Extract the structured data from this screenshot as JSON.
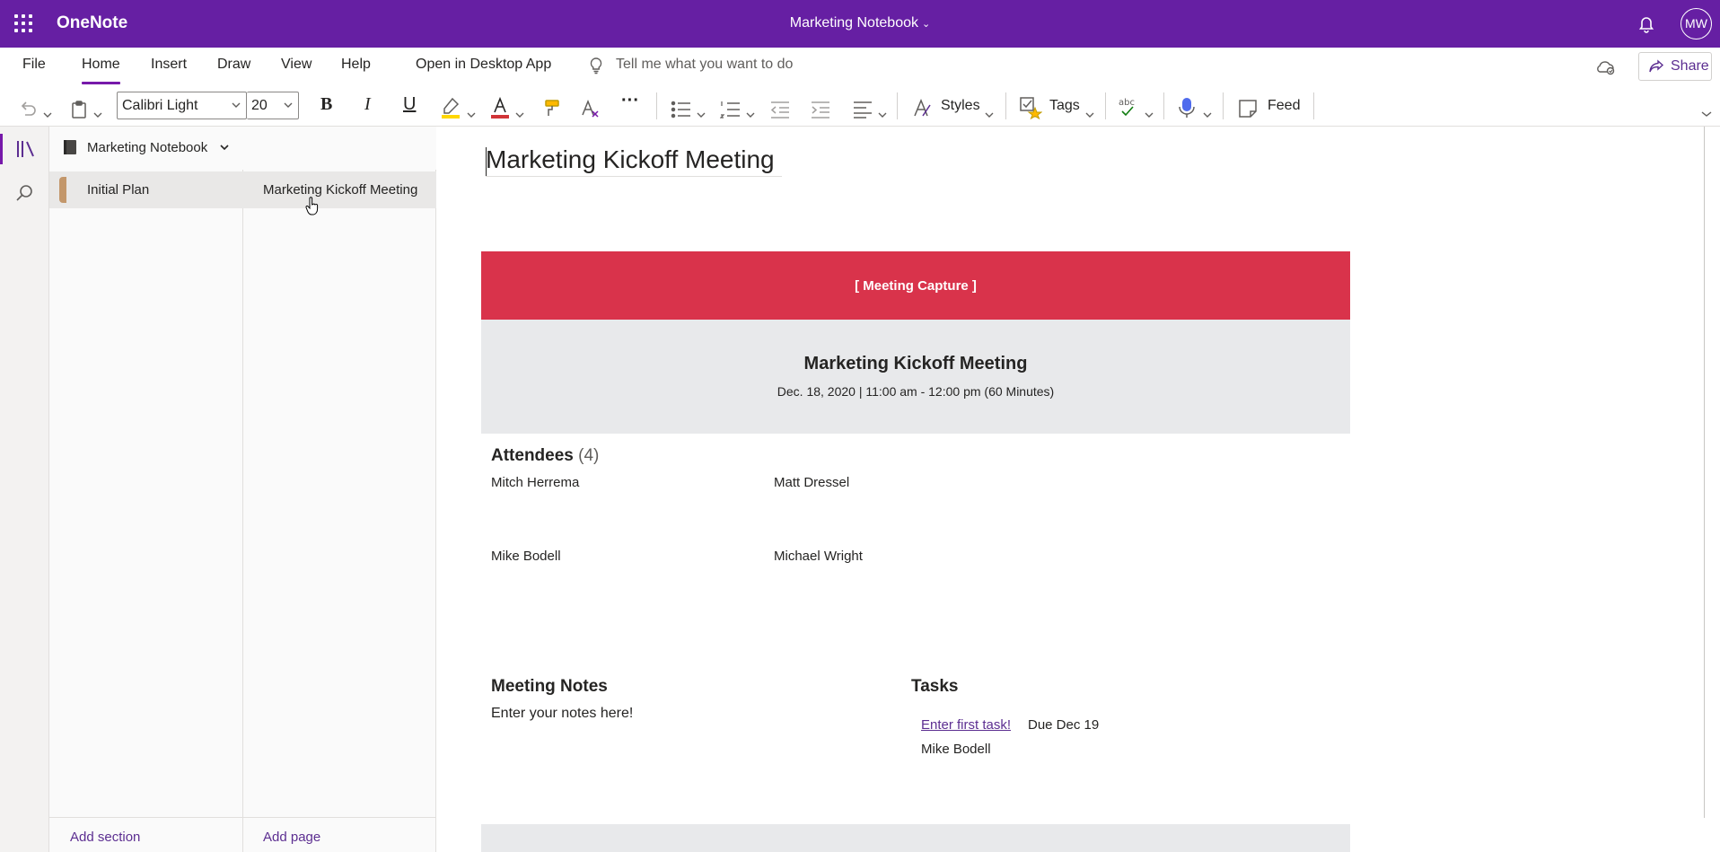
{
  "titlebar": {
    "app_name": "OneNote",
    "notebook_title": "Marketing Notebook",
    "avatar_initials": "MW"
  },
  "tabs": {
    "items": [
      "File",
      "Home",
      "Insert",
      "Draw",
      "View",
      "Help"
    ],
    "active": "Home",
    "open_desktop": "Open in Desktop App",
    "tell_me": "Tell me what you want to do",
    "share_label": "Share"
  },
  "ribbon": {
    "font_name": "Calibri Light",
    "font_size": "20",
    "bold": "B",
    "italic": "I",
    "underline": "U",
    "styles_label": "Styles",
    "tags_label": "Tags",
    "feed_label": "Feed",
    "accent_color": "#7719aa",
    "highlight_color": "#ffd700",
    "font_color": "#d13438"
  },
  "navigation": {
    "notebook_name": "Marketing Notebook",
    "sections": [
      {
        "label": "Initial Plan",
        "color": "#c3976b"
      }
    ],
    "pages": [
      {
        "label": "Marketing Kickoff Meeting"
      }
    ],
    "add_section": "Add section",
    "add_page": "Add page"
  },
  "page": {
    "title": "Marketing Kickoff Meeting",
    "banner_label": "[ Meeting Capture ]",
    "banner_color": "#d9334b",
    "meeting_title": "Marketing Kickoff Meeting",
    "meeting_datetime": "Dec. 18, 2020 | 11:00 am - 12:00 pm (60 Minutes)",
    "attendees_heading": "Attendees",
    "attendees_count": "(4)",
    "attendees": [
      "Mitch Herrema",
      "Matt Dressel",
      "Mike Bodell",
      "Michael Wright"
    ],
    "notes_heading": "Meeting Notes",
    "notes_placeholder": "Enter your notes here!",
    "tasks_heading": "Tasks",
    "task_link": "Enter first task!",
    "task_due": "Due Dec 19",
    "task_owner": "Mike Bodell"
  }
}
